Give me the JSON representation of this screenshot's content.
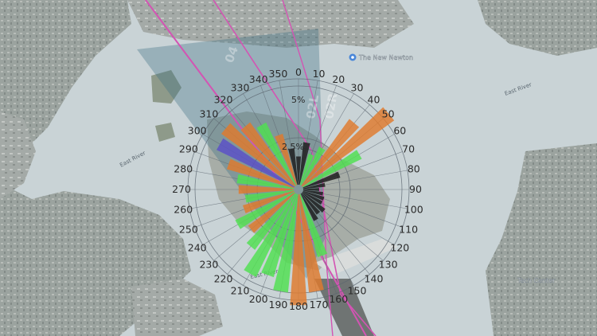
{
  "map": {
    "water_labels": [
      {
        "id": "east-river-1",
        "text": "East River"
      },
      {
        "id": "east-river-2",
        "text": "East River"
      },
      {
        "id": "east-river-3",
        "text": "East River"
      }
    ],
    "poi_labels": [
      {
        "id": "poi-newington",
        "text": "The New Newton"
      },
      {
        "id": "poi-sub",
        "text": "Tech Center"
      }
    ],
    "runway_labels": [
      {
        "text": "04"
      },
      {
        "text": "02L"
      },
      {
        "text": "02R"
      }
    ],
    "colors": {
      "water": "#c9d3d6",
      "land": "#a9b0ad",
      "cone": "#3b6f83",
      "route": "#d354b3",
      "bar_green": "#4fe04f",
      "bar_orange": "#e07a2c",
      "bar_purple": "#5a4fc8",
      "bar_dark": "#1b1b1b"
    }
  },
  "compass": {
    "degree_labels": [
      "0",
      "10",
      "20",
      "30",
      "40",
      "50",
      "60",
      "70",
      "80",
      "90",
      "100",
      "110",
      "120",
      "130",
      "140",
      "150",
      "160",
      "170",
      "180",
      "190",
      "200",
      "210",
      "220",
      "230",
      "240",
      "250",
      "260",
      "270",
      "280",
      "290",
      "300",
      "310",
      "320",
      "330",
      "340",
      "350"
    ],
    "ring_labels": [
      "5%",
      "2.5%"
    ]
  },
  "wind_rose": [
    {
      "dir": 0,
      "pct": 1.6,
      "color": "dark"
    },
    {
      "dir": 10,
      "pct": 2.3,
      "color": "dark"
    },
    {
      "dir": 20,
      "pct": 1.8,
      "color": "green"
    },
    {
      "dir": 30,
      "pct": 2.3,
      "color": "green"
    },
    {
      "dir": 40,
      "pct": 4.2,
      "color": "orange"
    },
    {
      "dir": 50,
      "pct": 5.7,
      "color": "orange"
    },
    {
      "dir": 60,
      "pct": 3.4,
      "color": "green"
    },
    {
      "dir": 70,
      "pct": 2.1,
      "color": "dark"
    },
    {
      "dir": 80,
      "pct": 1.3,
      "color": "dark"
    },
    {
      "dir": 90,
      "pct": 1.0,
      "color": "dark"
    },
    {
      "dir": 100,
      "pct": 1.2,
      "color": "dark"
    },
    {
      "dir": 110,
      "pct": 1.3,
      "color": "dark"
    },
    {
      "dir": 120,
      "pct": 1.3,
      "color": "dark"
    },
    {
      "dir": 130,
      "pct": 1.6,
      "color": "dark"
    },
    {
      "dir": 140,
      "pct": 1.5,
      "color": "dark"
    },
    {
      "dir": 150,
      "pct": 1.7,
      "color": "dark"
    },
    {
      "dir": 160,
      "pct": 3.4,
      "color": "green"
    },
    {
      "dir": 170,
      "pct": 5.0,
      "color": "orange"
    },
    {
      "dir": 180,
      "pct": 5.6,
      "color": "orange"
    },
    {
      "dir": 190,
      "pct": 5.0,
      "color": "green"
    },
    {
      "dir": 200,
      "pct": 4.4,
      "color": "green"
    },
    {
      "dir": 210,
      "pct": 4.7,
      "color": "green"
    },
    {
      "dir": 220,
      "pct": 3.6,
      "color": "green"
    },
    {
      "dir": 230,
      "pct": 3.0,
      "color": "orange"
    },
    {
      "dir": 240,
      "pct": 3.4,
      "color": "green"
    },
    {
      "dir": 250,
      "pct": 2.8,
      "color": "orange"
    },
    {
      "dir": 260,
      "pct": 2.6,
      "color": "green"
    },
    {
      "dir": 270,
      "pct": 2.9,
      "color": "orange"
    },
    {
      "dir": 280,
      "pct": 3.0,
      "color": "green"
    },
    {
      "dir": 290,
      "pct": 3.6,
      "color": "orange"
    },
    {
      "dir": 300,
      "pct": 4.4,
      "color": "purple"
    },
    {
      "dir": 310,
      "pct": 4.6,
      "color": "orange"
    },
    {
      "dir": 320,
      "pct": 4.0,
      "color": "orange"
    },
    {
      "dir": 330,
      "pct": 3.6,
      "color": "green"
    },
    {
      "dir": 340,
      "pct": 2.8,
      "color": "orange"
    },
    {
      "dir": 350,
      "pct": 2.0,
      "color": "dark"
    }
  ]
}
